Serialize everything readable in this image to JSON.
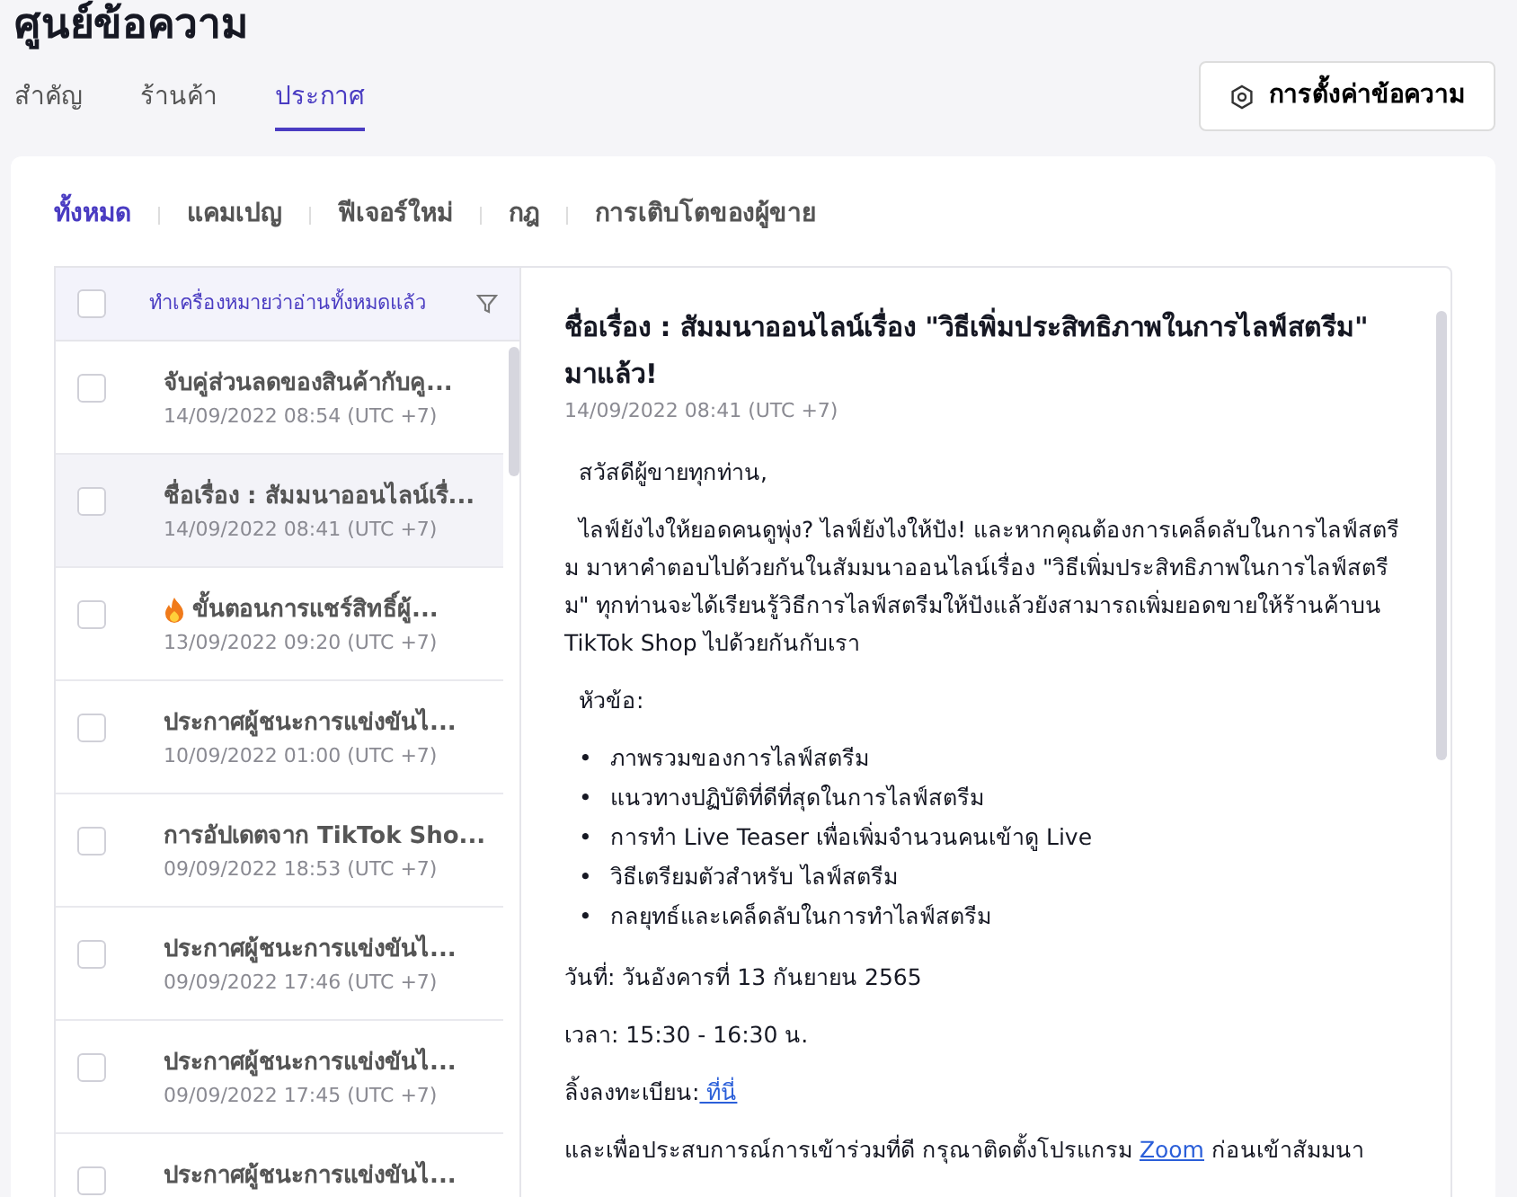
{
  "page_title": "ศูนย์ข้อความ",
  "tabs": [
    {
      "label": "สำคัญ",
      "selected": false
    },
    {
      "label": "ร้านค้า",
      "selected": false
    },
    {
      "label": "ประกาศ",
      "selected": true
    }
  ],
  "settings_button": "การตั้งค่าข้อความ",
  "filters": [
    {
      "label": "ทั้งหมด",
      "selected": true
    },
    {
      "label": "แคมเปญ",
      "selected": false
    },
    {
      "label": "ฟีเจอร์ใหม่",
      "selected": false
    },
    {
      "label": "กฎ",
      "selected": false
    },
    {
      "label": "การเติบโตของผู้ขาย",
      "selected": false
    }
  ],
  "list_header": {
    "checked": false,
    "action": "ทำเครื่องหมายว่าอ่านทั้งหมดแล้ว"
  },
  "messages": [
    {
      "kind": "plain",
      "title": "จับคู่ส่วนลดของสินค้ากับคู...",
      "time": "14/09/2022 08:54 (UTC +7)",
      "checked": false,
      "selected": false
    },
    {
      "kind": "plain",
      "title": "ชื่อเรื่อง : สัมมนาออนไลน์เรื่...",
      "time": "14/09/2022 08:41 (UTC +7)",
      "checked": false,
      "selected": true
    },
    {
      "kind": "fire",
      "title": "ขั้นตอนการแชร์สิทธิ์ผู้...",
      "time": "13/09/2022 09:20 (UTC +7)",
      "checked": false,
      "selected": false
    },
    {
      "kind": "plain",
      "title": "ประกาศผู้ชนะการแข่งขันไ...",
      "time": "10/09/2022 01:00 (UTC +7)",
      "checked": false,
      "selected": false
    },
    {
      "kind": "plain",
      "title": "การอัปเดตจาก TikTok Sho...",
      "time": "09/09/2022 18:53 (UTC +7)",
      "checked": false,
      "selected": false
    },
    {
      "kind": "plain",
      "title": "ประกาศผู้ชนะการแข่งขันไ...",
      "time": "09/09/2022 17:46 (UTC +7)",
      "checked": false,
      "selected": false
    },
    {
      "kind": "plain",
      "title": "ประกาศผู้ชนะการแข่งขันไ...",
      "time": "09/09/2022 17:45 (UTC +7)",
      "checked": false,
      "selected": false
    },
    {
      "kind": "plain",
      "title": "ประกาศผู้ชนะการแข่งขันไ...",
      "checked": false,
      "selected": false
    }
  ],
  "detail": {
    "title": "ชื่อเรื่อง : สัมมนาออนไลน์เรื่อง \"วิธีเพิ่มประสิทธิภาพในการไลฟ์สตรีม\" มาแล้ว!",
    "time": "14/09/2022 08:41 (UTC +7)",
    "body": [
      {
        "kind": "indented",
        "parts": [
          {
            "text": "สวัสดีผู้ขายทุกท่าน,",
            "link": false
          }
        ]
      },
      {
        "kind": "text",
        "parts": [
          {
            "text": "  ไลฟ์ยังไงให้ยอดคนดูพุ่ง? ไลฟ์ยังไงให้ปัง! และหากคุณต้องการเคล็ดลับในการไลฟ์สตรีม มาหาคำตอบไปด้วยกันในสัมมนาออนไลน์เรื่อง \"วิธีเพิ่มประสิทธิภาพในการไลฟ์สตรีม\" ทุกท่านจะได้เรียนรู้วิธีการไลฟ์สตรีมให้ปังแล้วยังสามารถเพิ่มยอดขายให้ร้านค้าบน TikTok Shop ไปด้วยกันกับเรา",
            "link": false
          }
        ]
      },
      {
        "kind": "indented",
        "parts": [
          {
            "text": "หัวข้อ:",
            "link": false
          }
        ]
      },
      {
        "kind": "list",
        "marker": "•",
        "items": [
          "ภาพรวมของการไลฟ์สตรีม",
          "แนวทางปฏิบัติที่ดีที่สุดในการไลฟ์สตรีม",
          "การทำ Live Teaser เพื่อเพิ่มจำนวนคนเข้าดู Live",
          "วิธีเตรียมตัวสำหรับ ไลฟ์สตรีม",
          "กลยุทธ์และเคล็ดลับในการทำไลฟ์สตรีม"
        ]
      },
      {
        "kind": "text",
        "parts": [
          {
            "text": "วันที่: วันอังคารที่ 13 กันยายน 2565",
            "link": false
          }
        ]
      },
      {
        "kind": "text",
        "parts": [
          {
            "text": "เวลา: 15:30 - 16:30 น.",
            "link": false
          }
        ]
      },
      {
        "kind": "text",
        "parts": [
          {
            "text": "ลิ้งลงทะเบียน:",
            "link": false
          },
          {
            "text": " ที่นี่",
            "link": true
          }
        ]
      },
      {
        "kind": "text",
        "parts": [
          {
            "text": "และเพื่อประสบการณ์การเข้าร่วมที่ดี กรุณาติดตั้งโปรแกรม ",
            "link": false
          },
          {
            "text": "Zoom",
            "link": true
          },
          {
            "text": " ก่อนเข้าสัมมนา",
            "link": false
          }
        ]
      }
    ]
  }
}
